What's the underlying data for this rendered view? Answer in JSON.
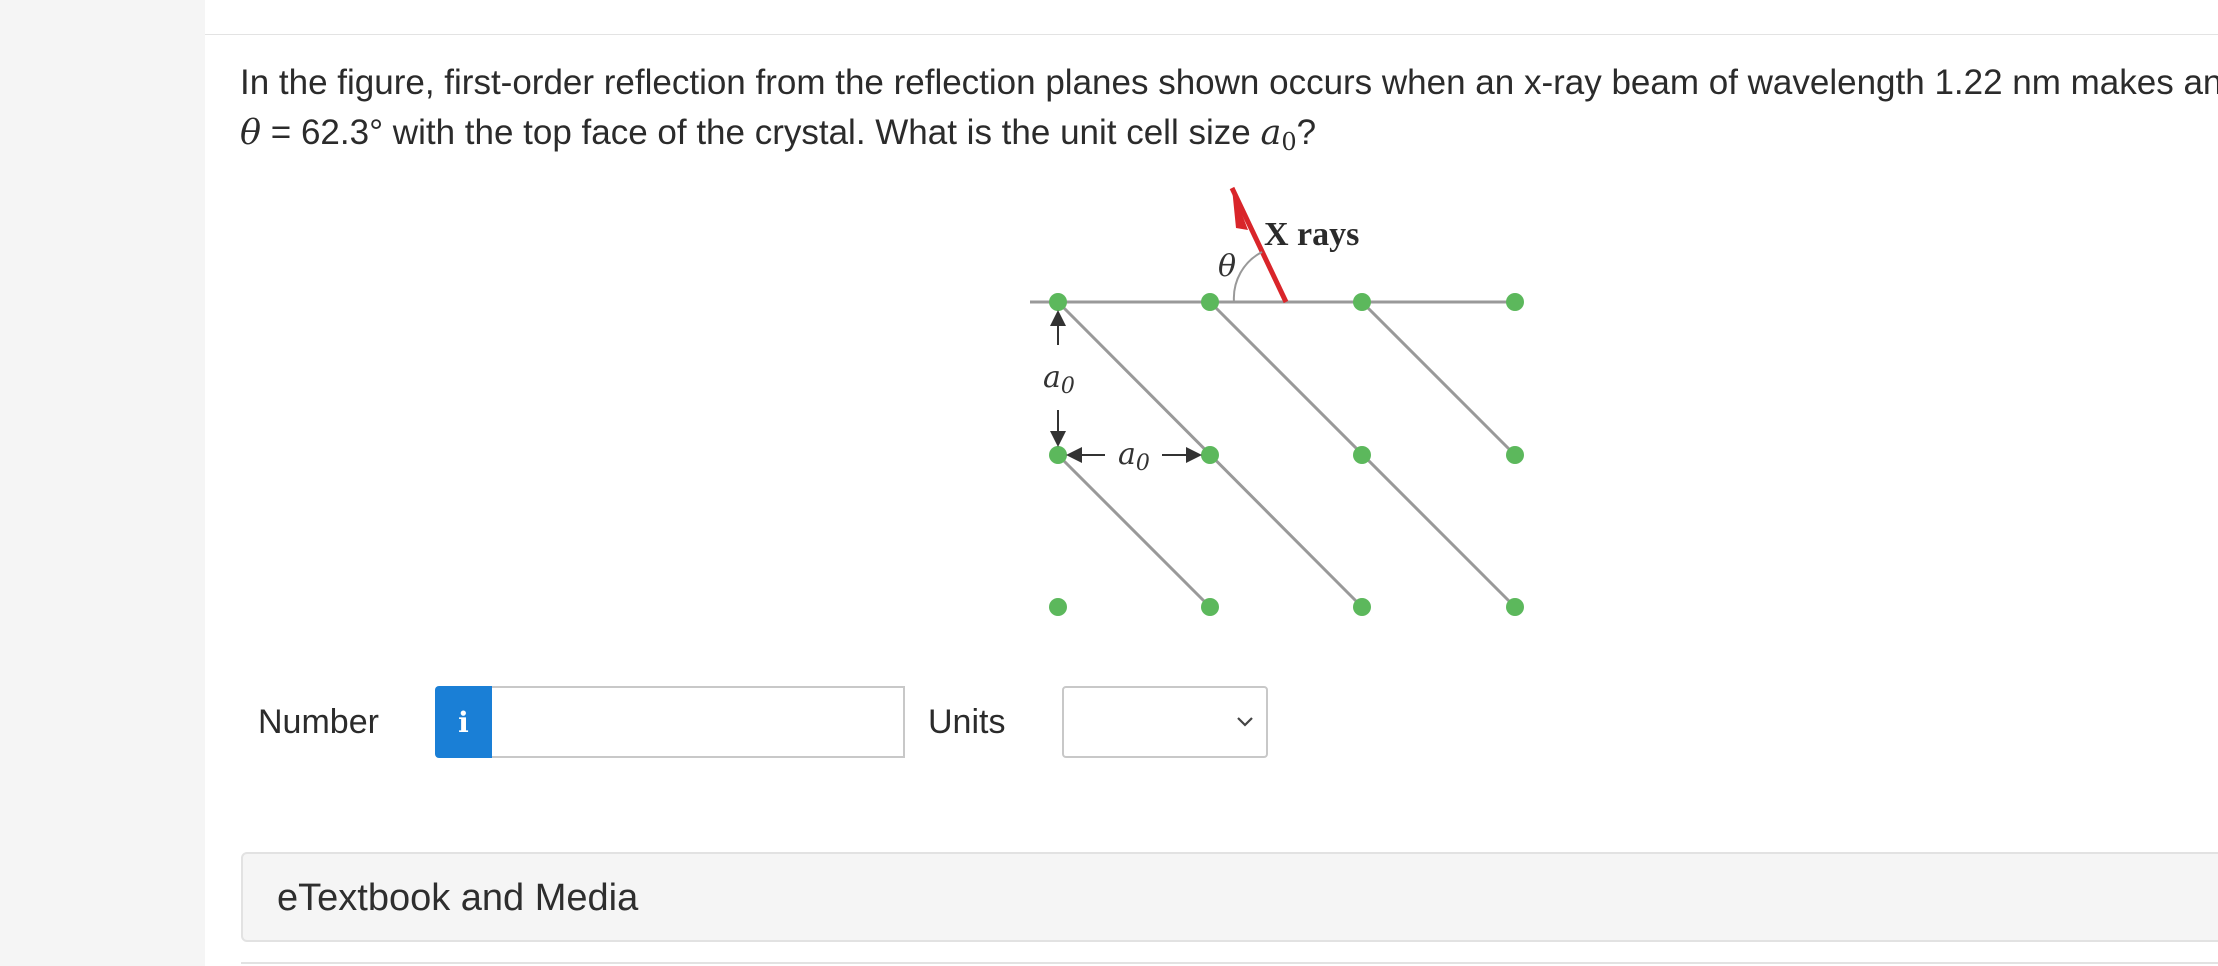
{
  "question": {
    "part1": "In the figure, first-order reflection from the reflection planes shown occurs when an x-ray beam of wavelength 1.22 nm makes an angle",
    "theta_symbol": "θ",
    "part2": " = 62.3° with the top face of the crystal. What is the unit cell size ",
    "a_symbol": "a",
    "a_subscript": "0",
    "part3": "?"
  },
  "figure": {
    "xrays_label": "X rays",
    "theta_label": "θ",
    "a0_vertical_label": "a",
    "a0_vertical_sub": "0",
    "a0_horizontal_label": "a",
    "a0_horizontal_sub": "0",
    "dot_color": "#5cb85c",
    "line_color": "#999999",
    "ray_color": "#d9252a"
  },
  "answer": {
    "number_label": "Number",
    "info_icon": "i",
    "number_value": "",
    "units_label": "Units",
    "units_value": ""
  },
  "media": {
    "title": "eTextbook and Media"
  }
}
